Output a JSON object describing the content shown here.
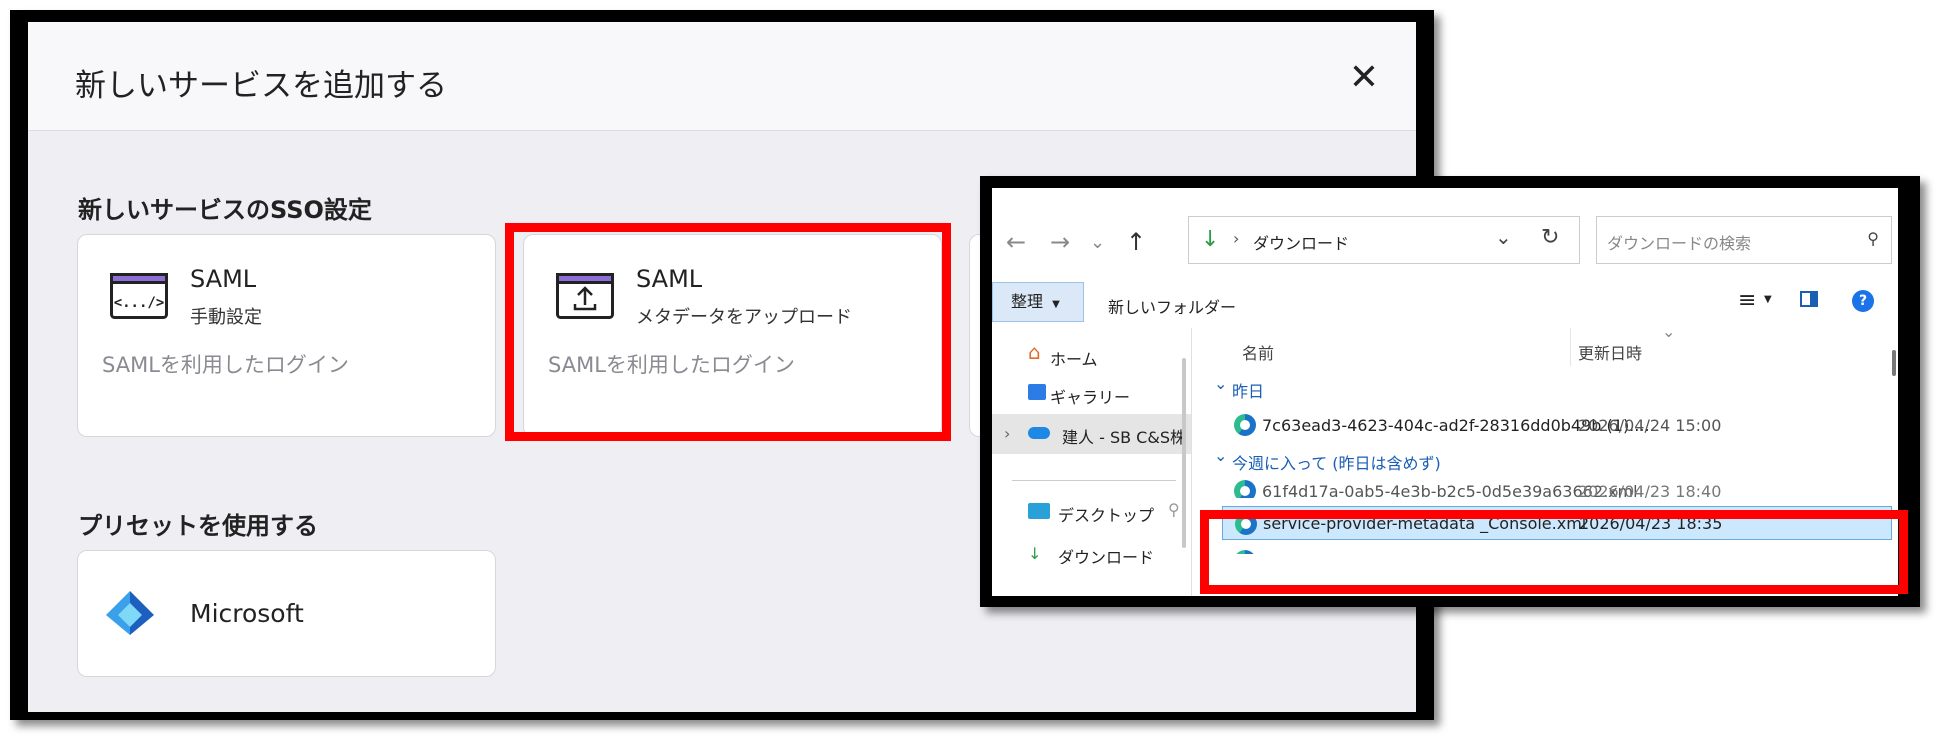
{
  "modal": {
    "title": "新しいサービスを追加する",
    "close_icon": "✕",
    "sso_section_title": "新しいサービスのSSO設定",
    "cards": [
      {
        "title": "SAML",
        "subtitle": "手動設定",
        "description": "SAMLを利用したログイン",
        "icon_text": "<.../>"
      },
      {
        "title": "SAML",
        "subtitle": "メタデータをアップロード",
        "description": "SAMLを利用したログイン"
      }
    ],
    "preset_section_title": "プリセットを使用する",
    "preset": {
      "label": "Microsoft"
    }
  },
  "explorer": {
    "address": "ダウンロード",
    "search_placeholder": "ダウンロードの検索",
    "organize": "整理",
    "new_folder": "新しいフォルダー",
    "nav": [
      {
        "label": "ホーム"
      },
      {
        "label": "ギャラリー"
      },
      {
        "label": "建人 - SB C&S株"
      },
      {
        "label": "デスクトップ"
      },
      {
        "label": "ダウンロード"
      }
    ],
    "columns": {
      "name": "名前",
      "date": "更新日時"
    },
    "groups": [
      {
        "label": "昨日"
      },
      {
        "label": "今週に入って (昨日は含めず)"
      }
    ],
    "files": [
      {
        "name": "7c63ead3-4623-404c-ad2f-28316dd0b49b (1)....",
        "date": "2026/04/24 15:00"
      },
      {
        "name": "61f4d17a-0ab5-4e3b-b2c5-0d5e39a63662.xml",
        "date": "2026/04/23 18:40"
      },
      {
        "name": "service-provider-metadata _Console.xml",
        "date": "2026/04/23 18:35"
      }
    ]
  },
  "colors": {
    "highlight": "#ff0000",
    "selected_row": "#cce8ff",
    "link_blue": "#1a5fb4"
  }
}
